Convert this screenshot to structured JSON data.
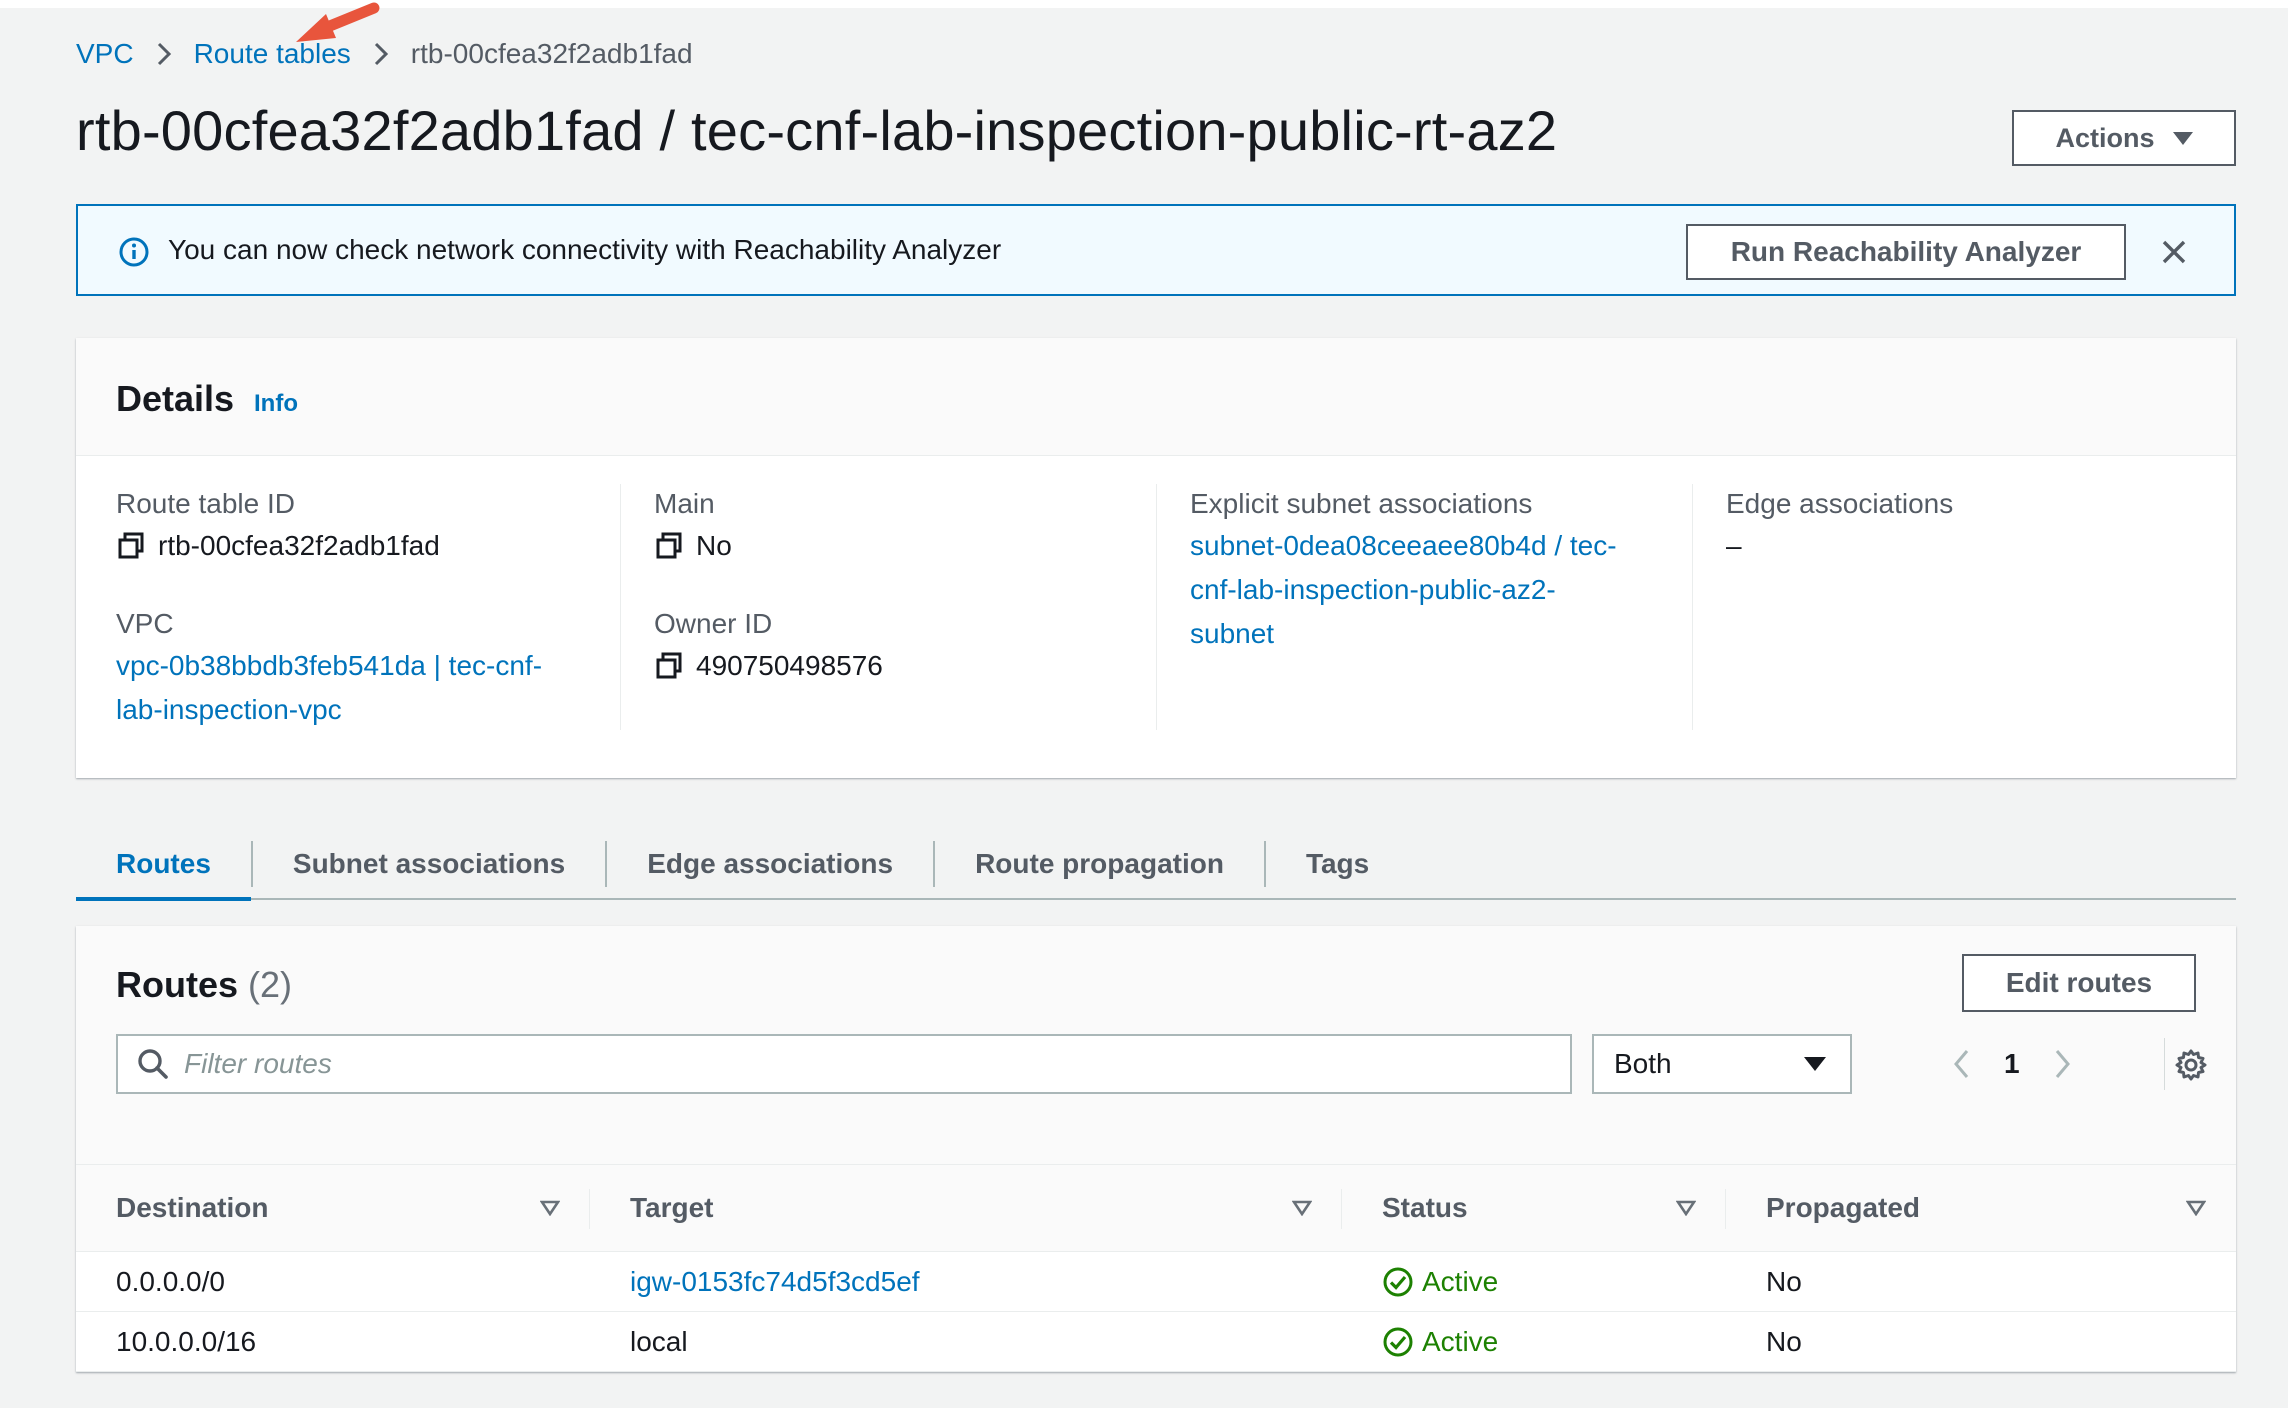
{
  "breadcrumb": {
    "items": [
      "VPC",
      "Route tables"
    ],
    "current": "rtb-00cfea32f2adb1fad"
  },
  "page": {
    "title": "rtb-00cfea32f2adb1fad / tec-cnf-lab-inspection-public-rt-az2",
    "actions_label": "Actions"
  },
  "banner": {
    "text": "You can now check network connectivity with Reachability Analyzer",
    "button_label": "Run Reachability Analyzer"
  },
  "details": {
    "title": "Details",
    "info_label": "Info",
    "route_table_id_label": "Route table ID",
    "route_table_id": "rtb-00cfea32f2adb1fad",
    "vpc_label": "VPC",
    "vpc_line1": "vpc-0b38bbdb3feb541da | tec-cnf-",
    "vpc_line2": "lab-inspection-vpc",
    "main_label": "Main",
    "main_value": "No",
    "owner_label": "Owner ID",
    "owner_value": "490750498576",
    "explicit_label": "Explicit subnet associations",
    "explicit_line1": "subnet-0dea08ceeaee80b4d / tec-",
    "explicit_line2": "cnf-lab-inspection-public-az2-",
    "explicit_line3": "subnet",
    "edge_label": "Edge associations",
    "edge_value": "–"
  },
  "tabs": [
    "Routes",
    "Subnet associations",
    "Edge associations",
    "Route propagation",
    "Tags"
  ],
  "routes": {
    "title": "Routes",
    "count": "(2)",
    "edit_label": "Edit routes",
    "filter_placeholder": "Filter routes",
    "select_value": "Both",
    "page_number": "1",
    "columns": [
      "Destination",
      "Target",
      "Status",
      "Propagated"
    ],
    "rows": [
      {
        "destination": "0.0.0.0/0",
        "target": "igw-0153fc74d5f3cd5ef",
        "status": "Active",
        "propagated": "No"
      },
      {
        "destination": "10.0.0.0/16",
        "target": "local",
        "status": "Active",
        "propagated": "No"
      }
    ]
  },
  "colors": {
    "link": "#0073bb",
    "success": "#1d8102",
    "annotation_arrow": "#e8553c"
  },
  "icons": {
    "banner": "info-icon",
    "close": "close-icon",
    "copy": "copy-icon",
    "search": "search-icon",
    "settings": "gear-icon",
    "status": "check-circle-icon"
  }
}
